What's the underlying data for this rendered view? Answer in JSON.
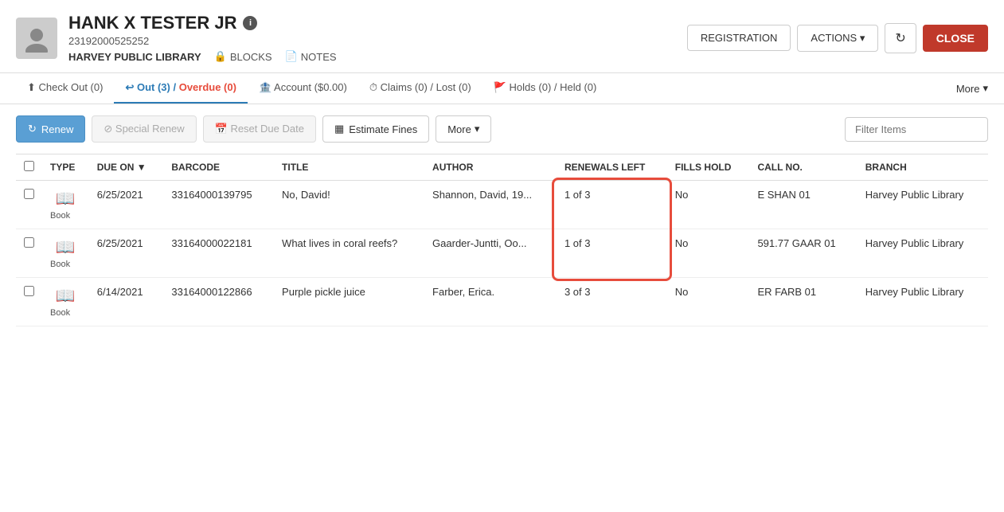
{
  "patron": {
    "name": "HANK X TESTER JR",
    "barcode": "23192000525252",
    "library": "HARVEY PUBLIC LIBRARY",
    "blocks_label": "BLOCKS",
    "notes_label": "NOTES"
  },
  "header_buttons": {
    "registration": "REGISTRATION",
    "actions": "ACTIONS",
    "refresh": "↻",
    "close": "CLOSE"
  },
  "tabs": [
    {
      "id": "checkout",
      "label": "Check Out (0)",
      "active": false
    },
    {
      "id": "out_overdue",
      "label": "Out (3) / Overdue (0)",
      "active": true
    },
    {
      "id": "account",
      "label": "Account ($0.00)",
      "active": false
    },
    {
      "id": "claims",
      "label": "Claims (0) / Lost (0)",
      "active": false
    },
    {
      "id": "holds",
      "label": "Holds (0) / Held (0)",
      "active": false
    }
  ],
  "tabs_more": "More",
  "toolbar": {
    "renew": "Renew",
    "special_renew": "Special Renew",
    "reset_due_date": "Reset Due Date",
    "estimate_fines": "Estimate Fines",
    "more": "More",
    "filter_placeholder": "Filter Items"
  },
  "table": {
    "columns": [
      {
        "id": "checkbox",
        "label": ""
      },
      {
        "id": "type",
        "label": "TYPE"
      },
      {
        "id": "due_on",
        "label": "DUE ON ▼"
      },
      {
        "id": "barcode",
        "label": "BARCODE"
      },
      {
        "id": "title",
        "label": "TITLE"
      },
      {
        "id": "author",
        "label": "AUTHOR"
      },
      {
        "id": "renewals_left",
        "label": "RENEWALS LEFT"
      },
      {
        "id": "fills_hold",
        "label": "FILLS HOLD"
      },
      {
        "id": "call_no",
        "label": "CALL NO."
      },
      {
        "id": "branch",
        "label": "BRANCH"
      }
    ],
    "rows": [
      {
        "type_icon": "📖",
        "type_label": "Book",
        "due_on": "6/25/2021",
        "barcode": "33164000139795",
        "title": "No, David!",
        "author": "Shannon, David, 19...",
        "renewals_left": "1 of 3",
        "fills_hold": "No",
        "call_no": "E SHAN 01",
        "branch": "Harvey Public Library"
      },
      {
        "type_icon": "📖",
        "type_label": "Book",
        "due_on": "6/25/2021",
        "barcode": "33164000022181",
        "title": "What lives in coral reefs?",
        "author": "Gaarder-Juntti, Oo...",
        "renewals_left": "1 of 3",
        "fills_hold": "No",
        "call_no": "591.77 GAAR 01",
        "branch": "Harvey Public Library"
      },
      {
        "type_icon": "📖",
        "type_label": "Book",
        "due_on": "6/14/2021",
        "barcode": "33164000122866",
        "title": "Purple pickle juice",
        "author": "Farber, Erica.",
        "renewals_left": "3 of 3",
        "fills_hold": "No",
        "call_no": "ER FARB 01",
        "branch": "Harvey Public Library"
      }
    ]
  }
}
